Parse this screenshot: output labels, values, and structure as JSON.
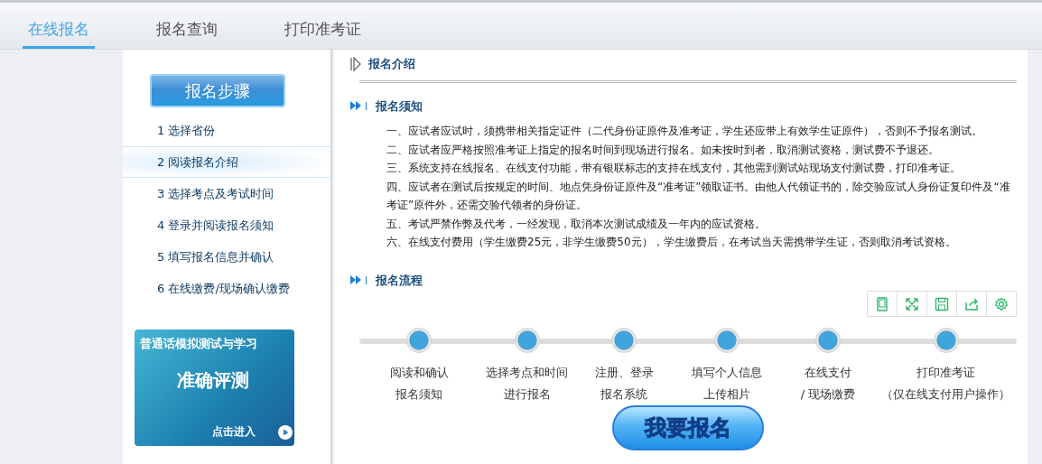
{
  "tabs": [
    {
      "label": "在线报名",
      "selected": true
    },
    {
      "label": "报名查询",
      "selected": false
    },
    {
      "label": "打印准考证",
      "selected": false
    }
  ],
  "sidebar": {
    "title": "报名步骤",
    "steps": [
      {
        "label": "1 选择省份",
        "selected": false
      },
      {
        "label": "2 阅读报名介绍",
        "selected": true
      },
      {
        "label": "3 选择考点及考试时间",
        "selected": false
      },
      {
        "label": "4 登录并阅读报名须知",
        "selected": false
      },
      {
        "label": "5 填写报名信息并确认",
        "selected": false
      },
      {
        "label": "6 在线缴费/现场确认缴费",
        "selected": false
      }
    ],
    "banner": {
      "subtitle": "普通话模拟测试与学习",
      "title": "准确评测",
      "action": "点击进入"
    }
  },
  "main": {
    "title": "报名介绍",
    "notice": {
      "heading": "报名须知",
      "items": [
        "一、应试者应试时，须携带相关指定证件（二代身份证原件及准考证，学生还应带上有效学生证原件），否则不予报名测试。",
        "二、应试者应严格按照准考证上指定的报名时间到现场进行报名。如未按时到者，取消测试资格，测试费不予退还。",
        "三、系统支持在线报名、在线支付功能，带有银联标志的支持在线支付，其他需到测试站现场支付测试费，打印准考证。",
        "四、应试者在测试后按规定的时间、地点凭身份证原件及“准考证”领取证书。由他人代领证书的，除交验应试人身份证复印件及“准考证”原件外，还需交验代领者的身份证。",
        "五、考试严禁作弊及代考，一经发现，取消本次测试成绩及一年内的应试资格。",
        "六、在线支付费用（学生缴费25元，非学生缴费50元），学生缴费后，在考试当天需携带学生证，否则取消考试资格。"
      ]
    },
    "flow": {
      "heading": "报名流程",
      "steps": [
        {
          "lines": [
            "阅读和确认",
            "报名须知"
          ]
        },
        {
          "lines": [
            "选择考点和时间",
            "进行报名"
          ]
        },
        {
          "lines": [
            "注册、登录",
            "报名系统"
          ]
        },
        {
          "lines": [
            "填写个人信息",
            "上传相片"
          ]
        },
        {
          "lines": [
            "在线支付",
            "/ 现场缴费"
          ]
        },
        {
          "lines": [
            "打印准考证",
            "（仅在线支付用户操作）"
          ]
        }
      ],
      "button": "我要报名"
    }
  }
}
